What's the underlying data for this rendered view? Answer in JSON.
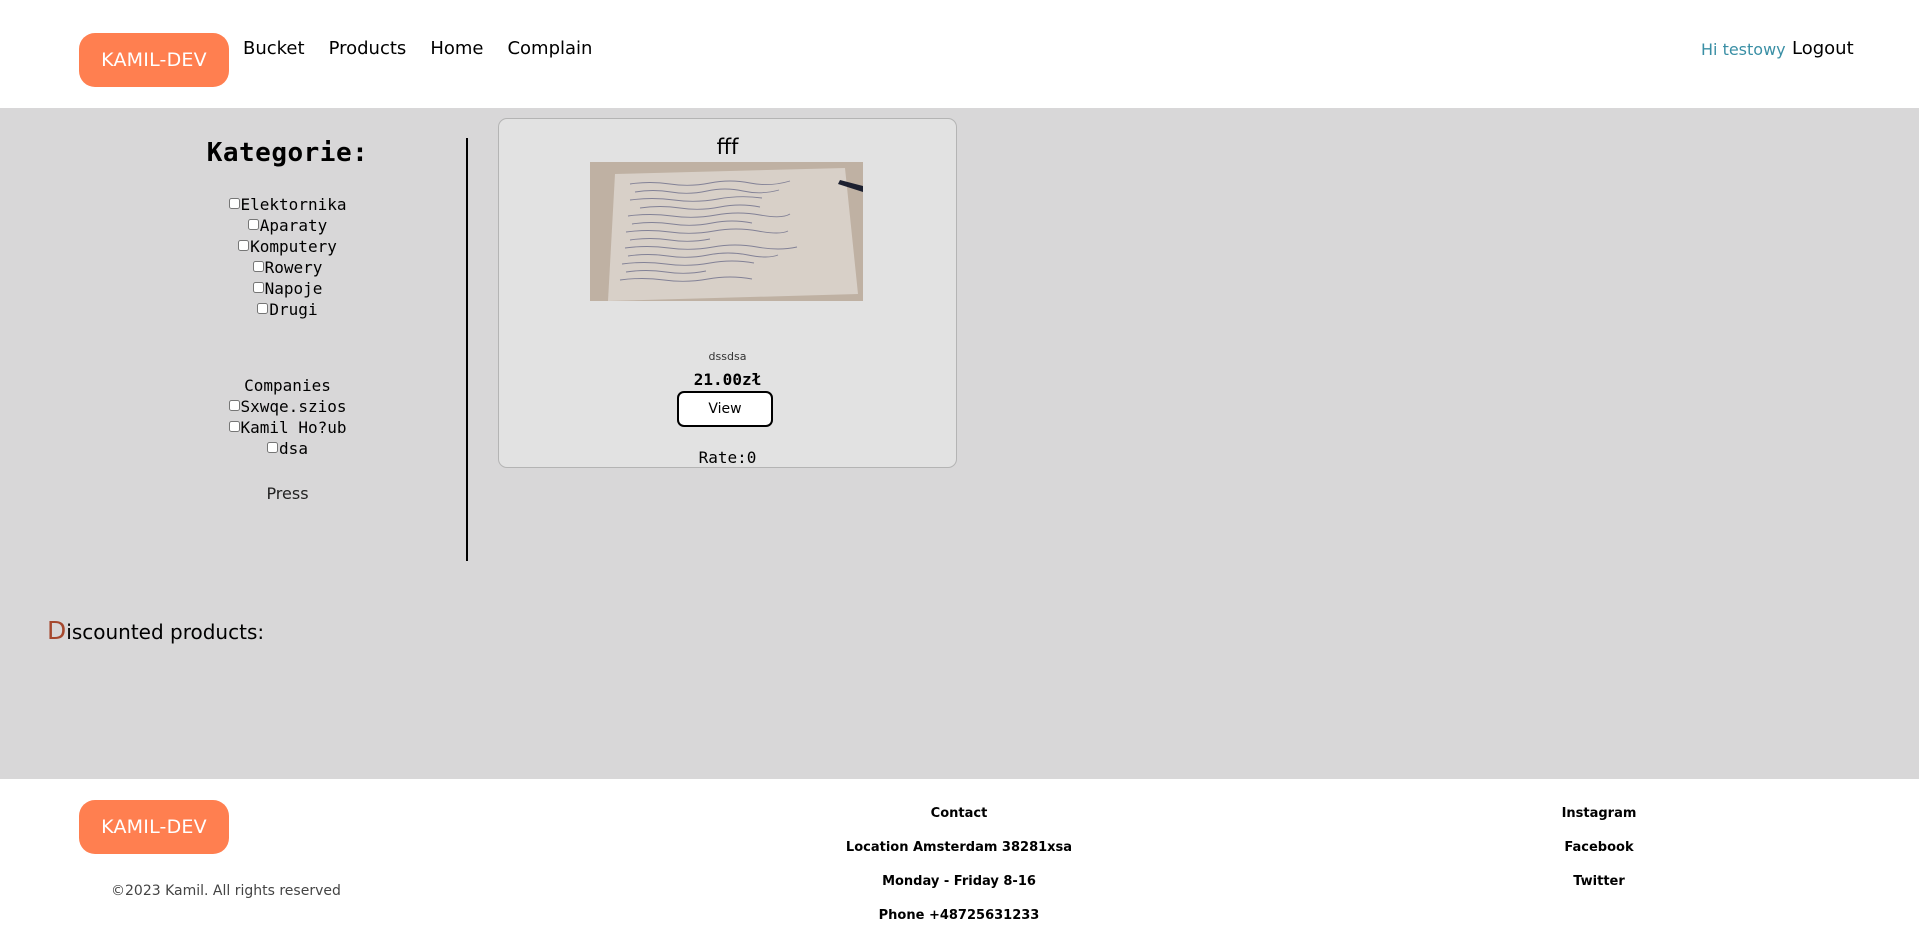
{
  "header": {
    "logo": "KAMIL-DEV",
    "nav": [
      "Bucket",
      "Products",
      "Home",
      "Complain"
    ],
    "greeting": "Hi testowy",
    "logout": "Logout"
  },
  "sidebar": {
    "title": "Kategorie:",
    "categories": [
      "Elektornika",
      "Aparaty",
      "Komputery",
      "Rowery",
      "Napoje",
      "Drugi"
    ],
    "companies_title": "Companies",
    "companies": [
      "Sxwqe.szios",
      "Kamil Ho?ub",
      "dsa"
    ],
    "press": "Press"
  },
  "product": {
    "title": "fff",
    "description": "dssdsa",
    "price": "21.00zł",
    "view_label": "View",
    "rate": "Rate:0"
  },
  "discounted": {
    "first_letter": "D",
    "rest": "iscounted products:"
  },
  "footer": {
    "logo": "KAMIL-DEV",
    "copyright": "©2023 Kamil. All rights reserved",
    "contact": [
      "Contact",
      "Location Amsterdam 38281xsa",
      "Monday - Friday 8-16",
      "Phone +48725631233"
    ],
    "social": [
      "Instagram",
      "Facebook",
      "Twitter"
    ]
  },
  "colors": {
    "accent": "#ff7f50",
    "main_bg": "#d8d7d8",
    "greeting": "#3a8fa5",
    "discount_letter": "#a5482e"
  }
}
